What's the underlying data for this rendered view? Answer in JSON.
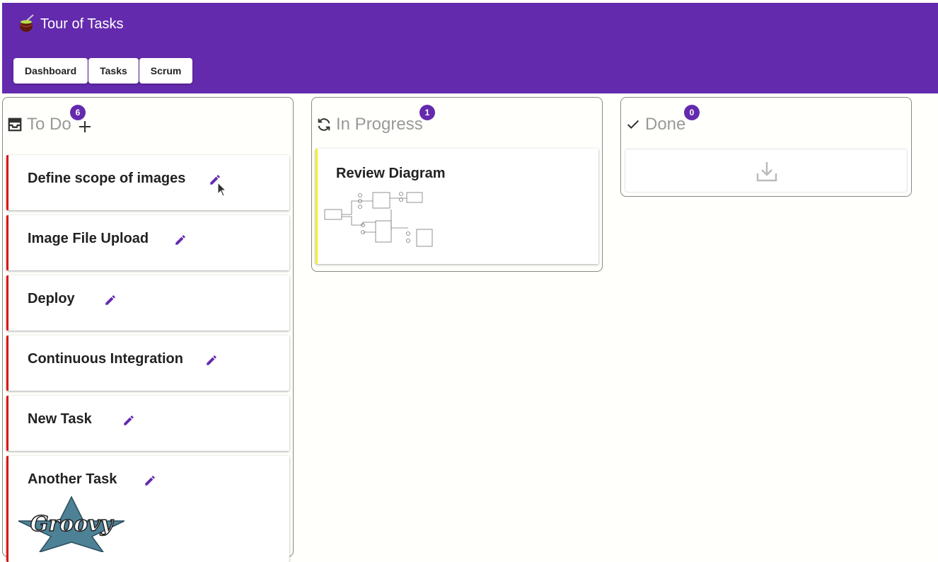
{
  "app": {
    "title": "Tour of Tasks",
    "logo_icon": "mate-gourd-icon"
  },
  "nav": [
    {
      "label": "Dashboard"
    },
    {
      "label": "Tasks"
    },
    {
      "label": "Scrum"
    }
  ],
  "columns": {
    "todo": {
      "title": "To Do",
      "count": "6",
      "icon": "inbox-icon"
    },
    "in_progress": {
      "title": "In Progress",
      "count": "1",
      "icon": "sync-icon"
    },
    "done": {
      "title": "Done",
      "count": "0",
      "icon": "check-icon"
    }
  },
  "todo_tasks": [
    {
      "title": "Define scope of images"
    },
    {
      "title": "Image File Upload"
    },
    {
      "title": "Deploy"
    },
    {
      "title": "Continuous Integration"
    },
    {
      "title": "New Task"
    },
    {
      "title": "Another Task",
      "image": "Groovy"
    }
  ],
  "in_progress_tasks": [
    {
      "title": "Review Diagram",
      "image": "diagram-thumbnail"
    }
  ],
  "colors": {
    "header": "#642aae",
    "accent": "#642aae",
    "todo_border": "#d11111",
    "progress_border": "#f5ee2a"
  }
}
